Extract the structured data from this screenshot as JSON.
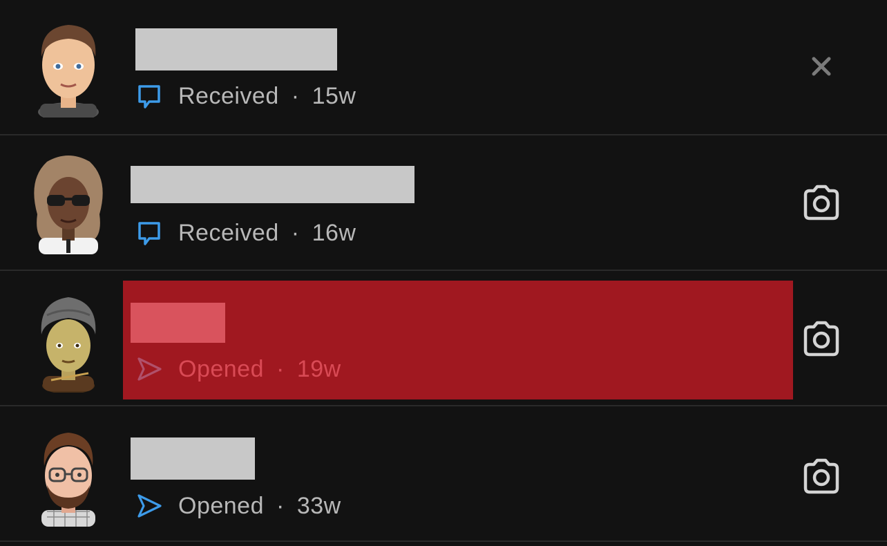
{
  "colors": {
    "background": "#121212",
    "divider": "#2a2a2a",
    "status_text": "#b8b8b8",
    "received_icon": "#3d9be9",
    "opened_icon": "#3d9be9",
    "highlight_bg": "#a01820",
    "highlight_text": "#d94a55",
    "highlight_icon": "#b0506a"
  },
  "rows": [
    {
      "avatar": "bitmoji-man-brown-hair",
      "status_icon": "chat-bubble-icon",
      "status": "Received",
      "separator": "·",
      "time": "15w",
      "action_icon": "close-icon"
    },
    {
      "avatar": "bitmoji-woman-curly-hair-sunglasses",
      "status_icon": "chat-bubble-icon",
      "status": "Received",
      "separator": "·",
      "time": "16w",
      "action_icon": "camera-icon"
    },
    {
      "avatar": "bitmoji-man-turban",
      "status_icon": "send-arrow-icon",
      "status": "Opened",
      "separator": "·",
      "time": "19w",
      "action_icon": "camera-icon",
      "highlighted": true
    },
    {
      "avatar": "bitmoji-man-glasses-beard",
      "status_icon": "send-arrow-icon",
      "status": "Opened",
      "separator": "·",
      "time": "33w",
      "action_icon": "camera-icon"
    }
  ]
}
